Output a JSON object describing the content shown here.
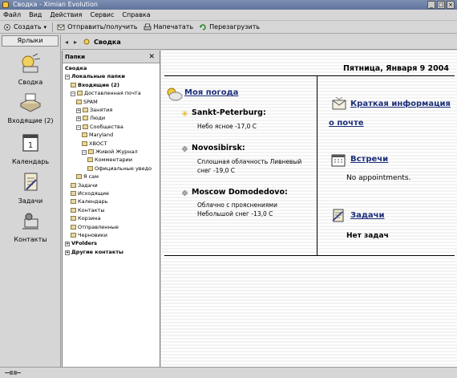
{
  "window": {
    "title": "Сводка - Ximian Evolution",
    "controls": [
      "_",
      "□",
      "×"
    ]
  },
  "menu": [
    "Файл",
    "Вид",
    "Действия",
    "Сервис",
    "Справка"
  ],
  "toolbar": {
    "new_label": "Создать",
    "new_arrow": "▾",
    "send_receive_label": "Отправить/получить",
    "print_label": "Напечатать",
    "reload_label": "Перезагрузить"
  },
  "shortcuts": {
    "header": "Ярлыки",
    "items": [
      {
        "label": "Сводка",
        "icon": "summary-icon"
      },
      {
        "label": "Входящие (2)",
        "icon": "inbox-icon"
      },
      {
        "label": "Календарь",
        "icon": "calendar-icon"
      },
      {
        "label": "Задачи",
        "icon": "tasks-icon"
      },
      {
        "label": "Контакты",
        "icon": "contacts-icon"
      }
    ]
  },
  "location": {
    "back": "◂",
    "forward": "▸",
    "title": "Сводка"
  },
  "folders": {
    "header": "Папки",
    "close": "✕",
    "tree": [
      {
        "label": "Сводка",
        "bold": true,
        "exp": "",
        "icon": false
      },
      {
        "label": "Локальные папки",
        "bold": true,
        "exp": "−",
        "icon": false
      },
      {
        "label": "Входящие (2)",
        "bold": true,
        "exp": "",
        "icon": true
      },
      {
        "label": "Доставленная почта",
        "bold": false,
        "exp": "−",
        "icon": true
      },
      {
        "label": "SPAM",
        "bold": false,
        "exp": "",
        "icon": true
      },
      {
        "label": "Занятия",
        "bold": false,
        "exp": "+",
        "icon": true
      },
      {
        "label": "Люди",
        "bold": false,
        "exp": "+",
        "icon": true
      },
      {
        "label": "Сообщества",
        "bold": false,
        "exp": "−",
        "icon": true
      },
      {
        "label": "Maryland",
        "bold": false,
        "exp": "",
        "icon": true
      },
      {
        "label": "ХВОСТ",
        "bold": false,
        "exp": "",
        "icon": true
      },
      {
        "label": "Живой Журнал",
        "bold": false,
        "exp": "−",
        "icon": true
      },
      {
        "label": "Комментарии",
        "bold": false,
        "exp": "",
        "icon": true
      },
      {
        "label": "Официальные уведо",
        "bold": false,
        "exp": "",
        "icon": true
      },
      {
        "label": "Я сам",
        "bold": false,
        "exp": "",
        "icon": true
      },
      {
        "label": "Задачи",
        "bold": false,
        "exp": "",
        "icon": true
      },
      {
        "label": "Исходящие",
        "bold": false,
        "exp": "",
        "icon": true
      },
      {
        "label": "Календарь",
        "bold": false,
        "exp": "",
        "icon": true
      },
      {
        "label": "Контакты",
        "bold": false,
        "exp": "",
        "icon": true
      },
      {
        "label": "Корзина",
        "bold": false,
        "exp": "",
        "icon": true
      },
      {
        "label": "Отправленные",
        "bold": false,
        "exp": "",
        "icon": true
      },
      {
        "label": "Черновики",
        "bold": false,
        "exp": "",
        "icon": true
      },
      {
        "label": "VFolders",
        "bold": true,
        "exp": "+",
        "icon": false
      },
      {
        "label": "Другие контакты",
        "bold": true,
        "exp": "+",
        "icon": false
      }
    ]
  },
  "summary": {
    "date": "Пятница, Января 9 2004",
    "weather": {
      "title": "Моя погода",
      "cities": [
        {
          "name": "Sankt-Peterburg:",
          "lines": [
            "Небо ясное -17,0 C"
          ],
          "icon": "sunny-icon"
        },
        {
          "name": "Novosibirsk:",
          "lines": [
            "Сплошная облачность Ливневый",
            "снег -19,0 C"
          ],
          "icon": "snow-icon"
        },
        {
          "name": "Moscow Domodedovo:",
          "lines": [
            "Облачно с прояснениями",
            "Небольшой снег -13,0 C"
          ],
          "icon": "snow-icon"
        }
      ]
    },
    "mail": {
      "title": "Краткая информация о почте"
    },
    "appointments": {
      "title": "Встречи",
      "text": "No appointments."
    },
    "tasks": {
      "title": "Задачи",
      "text": "Нет задач"
    }
  }
}
